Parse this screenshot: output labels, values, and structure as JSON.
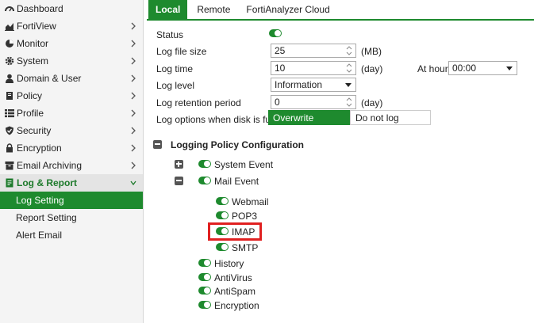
{
  "sidebar": {
    "items": [
      {
        "label": "Dashboard",
        "icon": "dashboard-icon",
        "chevron": false
      },
      {
        "label": "FortiView",
        "icon": "chart-icon",
        "chevron": true
      },
      {
        "label": "Monitor",
        "icon": "pie-chart-icon",
        "chevron": true
      },
      {
        "label": "System",
        "icon": "gear-icon",
        "chevron": true
      },
      {
        "label": "Domain & User",
        "icon": "user-icon",
        "chevron": true
      },
      {
        "label": "Policy",
        "icon": "policy-icon",
        "chevron": true
      },
      {
        "label": "Profile",
        "icon": "list-icon",
        "chevron": true
      },
      {
        "label": "Security",
        "icon": "shield-icon",
        "chevron": true
      },
      {
        "label": "Encryption",
        "icon": "lock-icon",
        "chevron": true
      },
      {
        "label": "Email Archiving",
        "icon": "archive-icon",
        "chevron": true
      },
      {
        "label": "Log & Report",
        "icon": "log-report-icon",
        "chevron": true
      }
    ],
    "sub_items": [
      "Log Setting",
      "Report Setting",
      "Alert Email"
    ]
  },
  "tabs": [
    "Local",
    "Remote",
    "FortiAnalyzer Cloud"
  ],
  "form": {
    "status_label": "Status",
    "log_file_size_label": "Log file size",
    "log_file_size_value": "25",
    "log_file_size_unit": "(MB)",
    "log_time_label": "Log time",
    "log_time_value": "10",
    "log_time_unit": "(day)",
    "at_hour_label": "At hour",
    "at_hour_value": "00:00",
    "log_level_label": "Log level",
    "log_level_value": "Information",
    "retention_label": "Log retention period",
    "retention_value": "0",
    "retention_unit": "(day)",
    "disk_full_label": "Log options when disk is full",
    "disk_full_options": [
      "Overwrite",
      "Do not log"
    ],
    "disk_full_selected": "Overwrite"
  },
  "policy": {
    "title": "Logging Policy Configuration",
    "system_event": "System Event",
    "mail_event": "Mail Event",
    "mail_children": [
      "Webmail",
      "POP3",
      "IMAP",
      "SMTP"
    ],
    "others": [
      "History",
      "AntiVirus",
      "AntiSpam",
      "Encryption"
    ]
  },
  "colors": {
    "accent": "#1e8a2e",
    "highlight": "#e02020"
  }
}
